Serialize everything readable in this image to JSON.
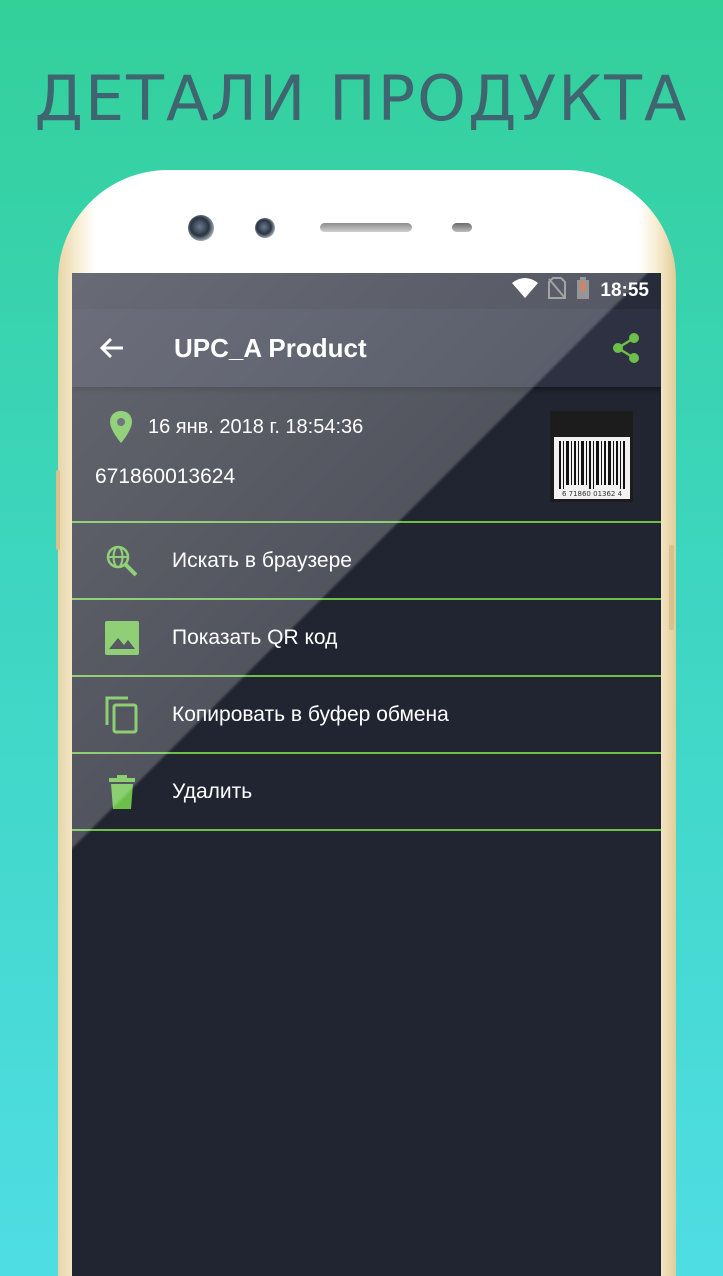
{
  "promo": {
    "headline": "ДЕТАЛИ ПРОДУКТА"
  },
  "status_bar": {
    "time": "18:55"
  },
  "toolbar": {
    "title": "UPC_A Product",
    "back_icon": "arrow-back-icon",
    "share_icon": "share-icon"
  },
  "product": {
    "date": "16 янв. 2018 г. 18:54:36",
    "code": "671860013624",
    "barcode_text": "6 71860 01362 4"
  },
  "menu": {
    "items": [
      {
        "label": "Искать в браузере",
        "icon": "web-search-icon"
      },
      {
        "label": "Показать QR код",
        "icon": "image-icon"
      },
      {
        "label": "Копировать в буфер обмена",
        "icon": "copy-icon"
      },
      {
        "label": "Удалить",
        "icon": "trash-icon"
      }
    ]
  },
  "colors": {
    "accent": "#6cc04a",
    "background": "#212431",
    "toolbar": "#2d3142"
  }
}
